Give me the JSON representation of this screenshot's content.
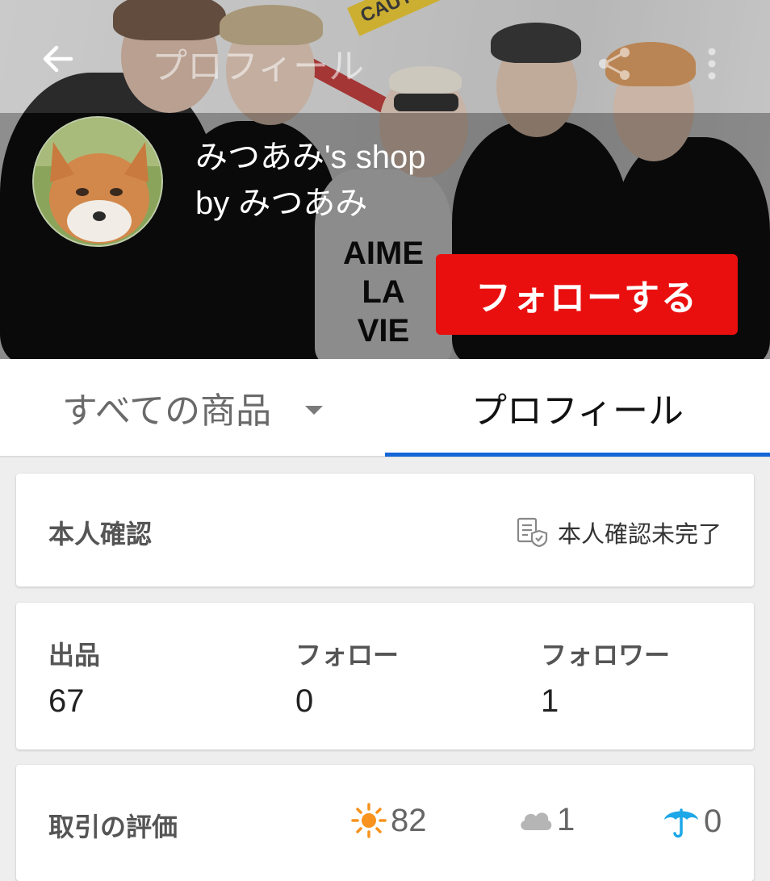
{
  "header": {
    "title": "プロフィール",
    "back_icon": "arrow-left-icon",
    "share_icon": "share-icon",
    "more_icon": "more-vert-icon"
  },
  "shop": {
    "name": "みつあみ's shop",
    "owner": "by みつあみ",
    "follow_button": "フォローする",
    "follow_color": "#ea0f0f",
    "hero_print": [
      "AIME",
      "LA",
      "VIE"
    ],
    "hero_tape": "CAUTION"
  },
  "tabs": {
    "all_items": "すべての商品",
    "profile": "プロフィール",
    "active_color": "#1565d8"
  },
  "verification": {
    "label": "本人確認",
    "status": "本人確認未完了"
  },
  "stats": [
    {
      "label": "出品",
      "value": "67"
    },
    {
      "label": "フォロー",
      "value": "0"
    },
    {
      "label": "フォロワー",
      "value": "1"
    }
  ],
  "ratings": {
    "label": "取引の評価",
    "good": {
      "icon": "sun-icon",
      "count": "82",
      "color": "#f7931e"
    },
    "normal": {
      "icon": "cloud-icon",
      "count": "1",
      "color": "#b5b5b5"
    },
    "bad": {
      "icon": "umbrella-icon",
      "count": "0",
      "color": "#1ea7e8"
    }
  }
}
